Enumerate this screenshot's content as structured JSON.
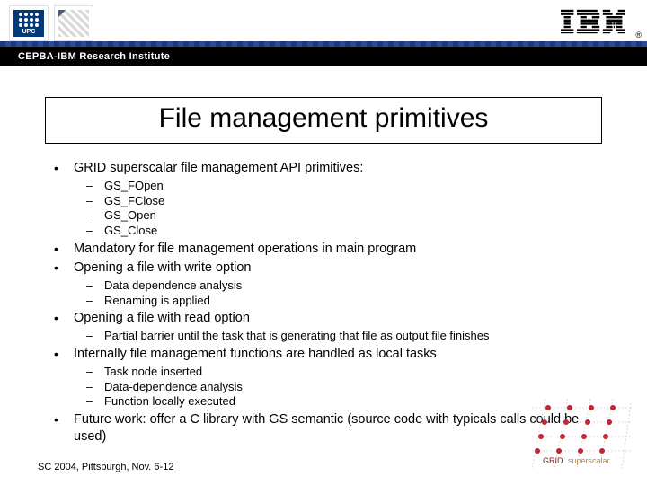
{
  "banner": {
    "institute_text": "CEPBA-IBM Research Institute",
    "upc_label": "UPC",
    "ibm_label": "IBM",
    "reg_mark": "®"
  },
  "title": "File management primitives",
  "bullets": [
    {
      "text": "GRID superscalar file management API primitives:",
      "sub": [
        "GS_FOpen",
        "GS_FClose",
        "GS_Open",
        "GS_Close"
      ]
    },
    {
      "text": "Mandatory for file management operations in main program",
      "sub": []
    },
    {
      "text": "Opening a file with write option",
      "sub": [
        "Data dependence analysis",
        "Renaming is applied"
      ]
    },
    {
      "text": "Opening a file with read option",
      "sub": [
        "Partial barrier until the task that is generating that file as output file finishes"
      ]
    },
    {
      "text": "Internally file management functions are handled as local tasks",
      "sub": [
        "Task node inserted",
        "Data-dependence analysis",
        "Function locally executed"
      ]
    },
    {
      "text": "Future work: offer a C library with GS semantic (source code with typicals calls could be used)",
      "sub": []
    }
  ],
  "footer": "SC 2004, Pittsburgh, Nov. 6-12",
  "corner_caption": "GRID superscalar"
}
